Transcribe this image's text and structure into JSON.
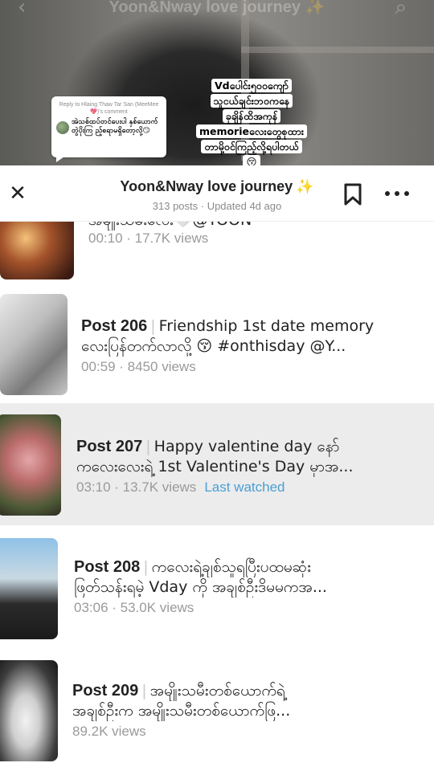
{
  "background": {
    "ghost_title": "Yoon&Nway love journey ✨",
    "back_glyph": "‹",
    "search_glyph": "⌕"
  },
  "reply_card": {
    "header": "Reply to Hlaing Thaw Tar San (MeeMee💖)'s comment",
    "text": "အဲသစ်ထပ်တင်ပေးပါ နှစ်ယောက်တွဲပိုးကြ ည့်စရာမရှိတော့လို့😏"
  },
  "caption": {
    "lines": [
      "Vdပေါင်း၅၀၀ကျော်",
      "သူငယ်ချင်းဘဝကနေ",
      "ခုချိန်ထိအကုန်",
      "memorieလေးတွေစုထား",
      "တာမို့ဝင်ကြည့်လို့ရပါတယ်",
      "😚"
    ]
  },
  "sheet": {
    "close_glyph": "✕",
    "title": "Yoon&Nway love journey",
    "title_sparkle": "✨",
    "subtitle": "313 posts · Updated 4d ago"
  },
  "posts": [
    {
      "number": "",
      "line1": "အမျိုးသမီးလေး🤍@YOON",
      "line2": "",
      "meta": "00:10 · 17.7K views",
      "last_watched": ""
    },
    {
      "number": "Post 206",
      "line1": "Friendship 1st date memory",
      "line2": "လေးပြန်တက်လာလို့ 😚 #onthisday @Y...",
      "meta": "00:59 · 8450 views",
      "last_watched": ""
    },
    {
      "number": "Post 207",
      "line1": "Happy valentine day နော်",
      "line2": "ကလေးလေးရဲ့ 1st Valentine's Day မှာအ...",
      "meta": "03:10 · 13.7K views",
      "last_watched": "Last watched"
    },
    {
      "number": "Post 208",
      "line1": "ကလေးရဲ့ချစ်သူရပြီးပထမဆုံး",
      "line2": "ဖြတ်သန်းရမဲ့ Vday ကို အချစ်ဦးဒိမမကအ...",
      "meta": "03:06 · 53.0K views",
      "last_watched": ""
    },
    {
      "number": "Post 209",
      "line1": "အမျိုးသမီးတစ်ယောက်ရဲ့",
      "line2": "အချစ်ဦးက အမျိုးသမီးတစ်ယောက်ဖြ...",
      "meta": "89.2K views",
      "last_watched": ""
    }
  ]
}
